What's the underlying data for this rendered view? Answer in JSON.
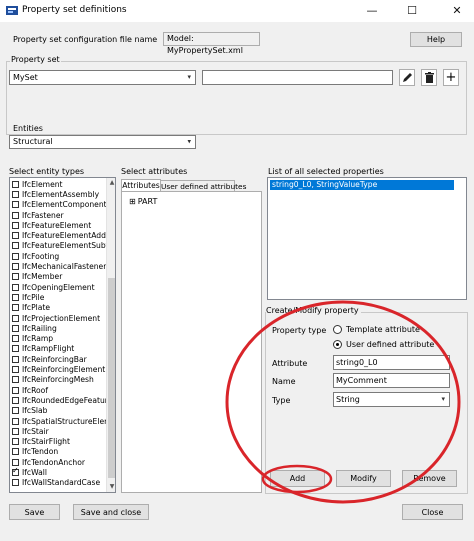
{
  "window": {
    "title": "Property set definitions",
    "minimize": "—",
    "maximize": "☐",
    "close": "✕"
  },
  "config": {
    "label": "Property set configuration file name",
    "value": "Model: MyPropertySet.xml",
    "help": "Help"
  },
  "property_set": {
    "label": "Property set",
    "selected": "MySet",
    "name_value": ""
  },
  "entities": {
    "label": "Entities",
    "selected": "Structural"
  },
  "entity_types": {
    "label": "Select entity types",
    "items": [
      {
        "name": "IfcElement",
        "checked": false
      },
      {
        "name": "IfcElementAssembly",
        "checked": false
      },
      {
        "name": "IfcElementComponent",
        "checked": false
      },
      {
        "name": "IfcFastener",
        "checked": false
      },
      {
        "name": "IfcFeatureElement",
        "checked": false
      },
      {
        "name": "IfcFeatureElementAdditio",
        "checked": false
      },
      {
        "name": "IfcFeatureElementSubtrac",
        "checked": false
      },
      {
        "name": "IfcFooting",
        "checked": false
      },
      {
        "name": "IfcMechanicalFastener",
        "checked": false
      },
      {
        "name": "IfcMember",
        "checked": false
      },
      {
        "name": "IfcOpeningElement",
        "checked": false
      },
      {
        "name": "IfcPile",
        "checked": false
      },
      {
        "name": "IfcPlate",
        "checked": false
      },
      {
        "name": "IfcProjectionElement",
        "checked": false
      },
      {
        "name": "IfcRailing",
        "checked": false
      },
      {
        "name": "IfcRamp",
        "checked": false
      },
      {
        "name": "IfcRampFlight",
        "checked": false
      },
      {
        "name": "IfcReinforcingBar",
        "checked": false
      },
      {
        "name": "IfcReinforcingElement",
        "checked": false
      },
      {
        "name": "IfcReinforcingMesh",
        "checked": false
      },
      {
        "name": "IfcRoof",
        "checked": false
      },
      {
        "name": "IfcRoundedEdgeFeature",
        "checked": false
      },
      {
        "name": "IfcSlab",
        "checked": false
      },
      {
        "name": "IfcSpatialStructureElemer",
        "checked": false
      },
      {
        "name": "IfcStair",
        "checked": false
      },
      {
        "name": "IfcStairFlight",
        "checked": false
      },
      {
        "name": "IfcTendon",
        "checked": false
      },
      {
        "name": "IfcTendonAnchor",
        "checked": false
      },
      {
        "name": "IfcWall",
        "checked": true
      },
      {
        "name": "IfcWallStandardCase",
        "checked": false
      }
    ]
  },
  "attributes": {
    "label": "Select attributes",
    "tabs": [
      "Attributes",
      "User defined attributes"
    ],
    "tree_expander": "⊞",
    "tree_root": "PART"
  },
  "selected_props": {
    "label": "List of all selected properties",
    "items": [
      "string0_L0,  StringValueType"
    ]
  },
  "create_modify": {
    "label": "Create/Modify property",
    "property_type_label": "Property type",
    "template_option": "Template attribute",
    "user_defined_option": "User defined attribute",
    "attribute_label": "Attribute",
    "attribute_value": "string0_L0",
    "name_label": "Name",
    "name_value": "MyComment",
    "type_label": "Type",
    "type_value": "String",
    "add": "Add",
    "modify": "Modify",
    "remove": "Remove"
  },
  "footer": {
    "save": "Save",
    "save_close": "Save and close",
    "close": "Close"
  },
  "colors": {
    "selection": "#0078d7",
    "highlight_ellipse": "#d9252a"
  }
}
